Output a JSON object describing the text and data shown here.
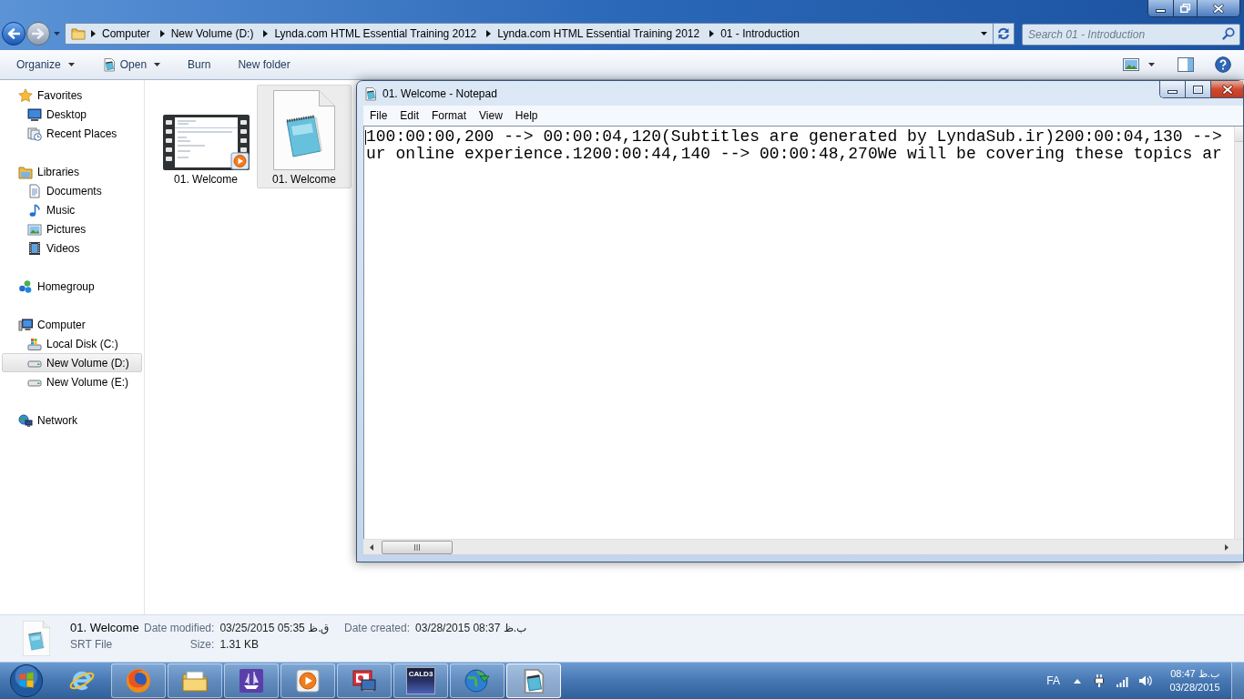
{
  "explorer": {
    "address_bar": {
      "breadcrumbs": [
        "Computer",
        "New Volume (D:)",
        "Lynda.com HTML Essential Training 2012",
        "Lynda.com HTML Essential Training 2012",
        "01 - Introduction"
      ]
    },
    "search": {
      "placeholder": "Search 01 - Introduction"
    },
    "toolbar": [
      {
        "label": "Organize",
        "kind": "menu"
      },
      {
        "label": "Open",
        "kind": "split"
      },
      {
        "label": "Burn",
        "kind": "plain"
      },
      {
        "label": "New folder",
        "kind": "plain"
      }
    ],
    "navigation": [
      {
        "label": "Favorites",
        "kind": "favorites",
        "selected": false,
        "children": [
          {
            "label": "Desktop",
            "kind": "desktop",
            "selected": false
          },
          {
            "label": "Recent Places",
            "kind": "recent",
            "selected": false
          }
        ]
      },
      {
        "label": "Libraries",
        "kind": "libraries",
        "selected": false,
        "children": [
          {
            "label": "Documents",
            "kind": "documents",
            "selected": false
          },
          {
            "label": "Music",
            "kind": "music",
            "selected": false
          },
          {
            "label": "Pictures",
            "kind": "pictures",
            "selected": false
          },
          {
            "label": "Videos",
            "kind": "videos",
            "selected": false
          }
        ]
      },
      {
        "label": "Homegroup",
        "kind": "homegroup",
        "selected": false
      },
      {
        "label": "Computer",
        "kind": "computer",
        "selected": false,
        "children": [
          {
            "label": "Local Disk (C:)",
            "kind": "systemdrive",
            "selected": false
          },
          {
            "label": "New Volume (D:)",
            "kind": "drive",
            "selected": true
          },
          {
            "label": "New Volume (E:)",
            "kind": "drive",
            "selected": false
          }
        ]
      },
      {
        "label": "Network",
        "kind": "network",
        "selected": false
      }
    ],
    "files": [
      {
        "name": "01. Welcome",
        "kind": "video",
        "selected": false
      },
      {
        "name": "01. Welcome",
        "kind": "text",
        "selected": true
      }
    ],
    "details": {
      "name": "01. Welcome",
      "type": "SRT File",
      "columns": [
        [
          {
            "label": "Date modified:",
            "value": "03/25/2015 05:35 ق.ظ"
          },
          {
            "label": "Size:",
            "value": "1.31 KB"
          }
        ],
        [
          {
            "label": "Date created:",
            "value": "03/28/2015 08:37 ب.ظ"
          }
        ]
      ]
    }
  },
  "notepad": {
    "title": "01. Welcome - Notepad",
    "menu": [
      "File",
      "Edit",
      "Format",
      "View",
      "Help"
    ],
    "lines": [
      "100:00:00,200 --> 00:00:04,120(Subtitles are generated by LyndaSub.ir)200:00:04,130 -->",
      "ur online experience.1200:00:44,140 --> 00:00:48,270We will be covering these topics ar"
    ]
  },
  "taskbar": {
    "apps": [
      {
        "kind": "ie",
        "running": false,
        "selected": false
      },
      {
        "kind": "firefox",
        "running": true,
        "selected": false
      },
      {
        "kind": "explorer",
        "running": true,
        "selected": false
      },
      {
        "kind": "ship",
        "running": true,
        "selected": false
      },
      {
        "kind": "player",
        "running": true,
        "selected": false
      },
      {
        "kind": "slides",
        "running": true,
        "selected": false
      },
      {
        "kind": "dictionary",
        "label": "CALD3",
        "running": true,
        "selected": false
      },
      {
        "kind": "globe",
        "running": true,
        "selected": false
      },
      {
        "kind": "notepad",
        "running": true,
        "selected": true
      }
    ],
    "tray": {
      "language": "FA",
      "time": "08:47 ب.ظ",
      "date": "03/28/2015"
    }
  }
}
